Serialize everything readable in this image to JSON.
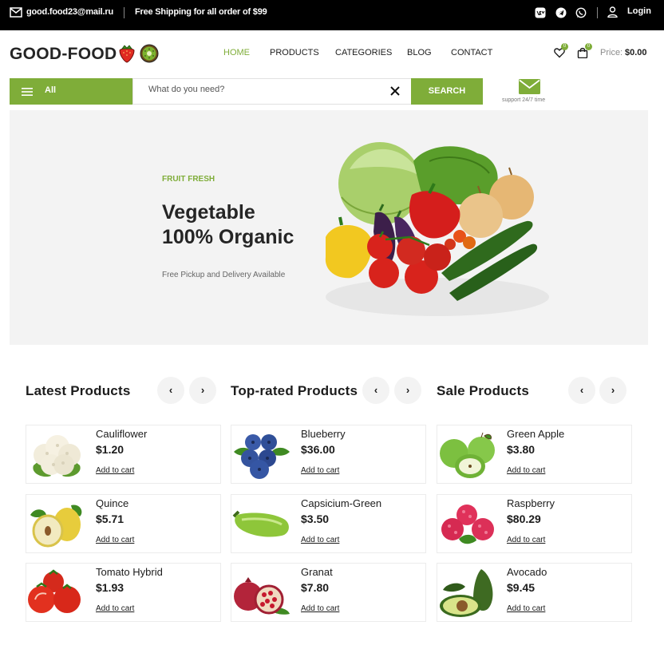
{
  "topbar": {
    "email": "good.food23@mail.ru",
    "shipping": "Free Shipping for all order of $99",
    "login": "Login",
    "icons": [
      "mail-icon",
      "vk-icon",
      "telegram-icon",
      "whatsapp-icon",
      "user-icon"
    ]
  },
  "header": {
    "logo": "GOOD-FOOD",
    "nav": [
      "HOME",
      "PRODUCTS",
      "CATEGORIES",
      "BLOG",
      "CONTACT"
    ],
    "active_nav": "HOME",
    "wishlist_count": "0",
    "cart_count": "0",
    "price_label": "Price:",
    "price_value": "$0.00"
  },
  "search": {
    "category_label": "All",
    "placeholder": "What do you need?",
    "button": "SEARCH",
    "support": "support 24/7 time"
  },
  "hero": {
    "kicker": "FRUIT FRESH",
    "title_line1": "Vegetable",
    "title_line2": "100% Organic",
    "subtitle": "Free Pickup and Delivery Available"
  },
  "sections": [
    {
      "title": "Latest Products",
      "products": [
        {
          "name": "Cauliflower",
          "price": "$1.20",
          "cart": "Add to cart"
        },
        {
          "name": "Quince",
          "price": "$5.71",
          "cart": "Add to cart"
        },
        {
          "name": "Tomato Hybrid",
          "price": "$1.93",
          "cart": "Add to cart"
        }
      ]
    },
    {
      "title": "Top-rated Products",
      "products": [
        {
          "name": "Blueberry",
          "price": "$36.00",
          "cart": "Add to cart"
        },
        {
          "name": "Capsicium-Green",
          "price": "$3.50",
          "cart": "Add to cart"
        },
        {
          "name": "Granat",
          "price": "$7.80",
          "cart": "Add to cart"
        }
      ]
    },
    {
      "title": "Sale Products",
      "products": [
        {
          "name": "Green Apple",
          "price": "$3.80",
          "cart": "Add to cart"
        },
        {
          "name": "Raspberry",
          "price": "$80.29",
          "cart": "Add to cart"
        },
        {
          "name": "Avocado",
          "price": "$9.45",
          "cart": "Add to cart"
        }
      ]
    }
  ],
  "arrows": {
    "prev": "‹",
    "next": "›"
  },
  "colors": {
    "accent": "#7fad39",
    "topbar": "#000000",
    "hero_bg": "#f3f3f3"
  }
}
